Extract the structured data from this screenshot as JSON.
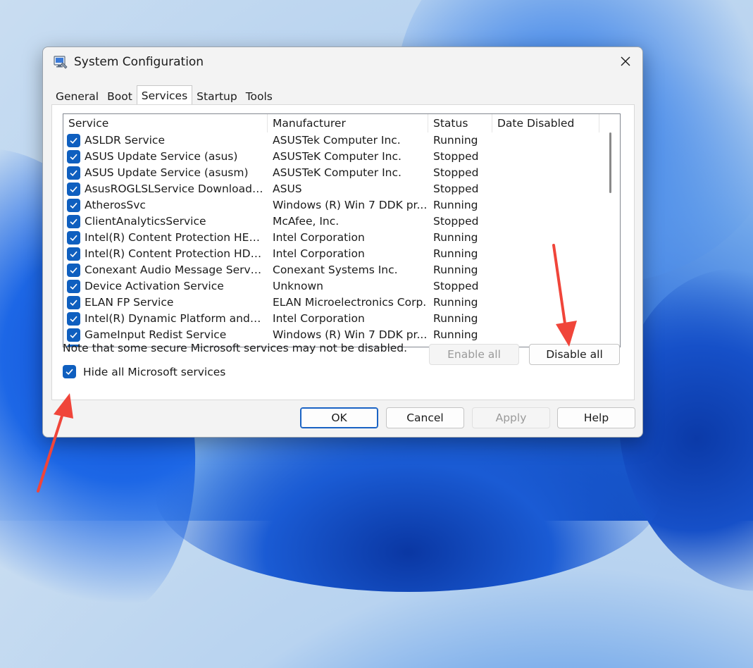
{
  "window": {
    "title": "System Configuration"
  },
  "tabs": [
    {
      "label": "General",
      "active": false
    },
    {
      "label": "Boot",
      "active": false
    },
    {
      "label": "Services",
      "active": true
    },
    {
      "label": "Startup",
      "active": false
    },
    {
      "label": "Tools",
      "active": false
    }
  ],
  "services_table": {
    "headers": {
      "service": "Service",
      "manufacturer": "Manufacturer",
      "status": "Status",
      "date_disabled": "Date Disabled"
    },
    "rows": [
      {
        "checked": true,
        "service": "ASLDR Service",
        "manufacturer": "ASUSTek Computer Inc.",
        "status": "Running",
        "date_disabled": ""
      },
      {
        "checked": true,
        "service": "ASUS Update Service (asus)",
        "manufacturer": "ASUSTeK Computer Inc.",
        "status": "Stopped",
        "date_disabled": ""
      },
      {
        "checked": true,
        "service": "ASUS Update Service (asusm)",
        "manufacturer": "ASUSTeK Computer Inc.",
        "status": "Stopped",
        "date_disabled": ""
      },
      {
        "checked": true,
        "service": "AsusROGLSLService Download R...",
        "manufacturer": "ASUS",
        "status": "Stopped",
        "date_disabled": ""
      },
      {
        "checked": true,
        "service": "AtherosSvc",
        "manufacturer": "Windows (R) Win 7 DDK pr...",
        "status": "Running",
        "date_disabled": ""
      },
      {
        "checked": true,
        "service": "ClientAnalyticsService",
        "manufacturer": "McAfee, Inc.",
        "status": "Stopped",
        "date_disabled": ""
      },
      {
        "checked": true,
        "service": "Intel(R) Content Protection HECI ...",
        "manufacturer": "Intel Corporation",
        "status": "Running",
        "date_disabled": ""
      },
      {
        "checked": true,
        "service": "Intel(R) Content Protection HDCP ...",
        "manufacturer": "Intel Corporation",
        "status": "Running",
        "date_disabled": ""
      },
      {
        "checked": true,
        "service": "Conexant Audio Message Service",
        "manufacturer": "Conexant Systems Inc.",
        "status": "Running",
        "date_disabled": ""
      },
      {
        "checked": true,
        "service": "Device Activation Service",
        "manufacturer": "Unknown",
        "status": "Stopped",
        "date_disabled": ""
      },
      {
        "checked": true,
        "service": "ELAN FP Service",
        "manufacturer": "ELAN Microelectronics Corp.",
        "status": "Running",
        "date_disabled": ""
      },
      {
        "checked": true,
        "service": "Intel(R) Dynamic Platform and Th...",
        "manufacturer": "Intel Corporation",
        "status": "Running",
        "date_disabled": ""
      },
      {
        "checked": true,
        "service": "GameInput Redist Service",
        "manufacturer": "Windows (R) Win 7 DDK pr...",
        "status": "Running",
        "date_disabled": ""
      }
    ]
  },
  "note": "Note that some secure Microsoft services may not be disabled.",
  "buttons": {
    "enable_all": "Enable all",
    "disable_all": "Disable all",
    "ok": "OK",
    "cancel": "Cancel",
    "apply": "Apply",
    "help": "Help"
  },
  "hide_ms": {
    "label": "Hide all Microsoft services",
    "checked": true
  },
  "colors": {
    "checkbox": "#0f5fbf",
    "arrow": "#f0453a"
  },
  "icons": {
    "app": "msconfig-icon",
    "close": "close-icon",
    "check": "checkmark-icon",
    "annotation": "red-arrow-icon"
  }
}
